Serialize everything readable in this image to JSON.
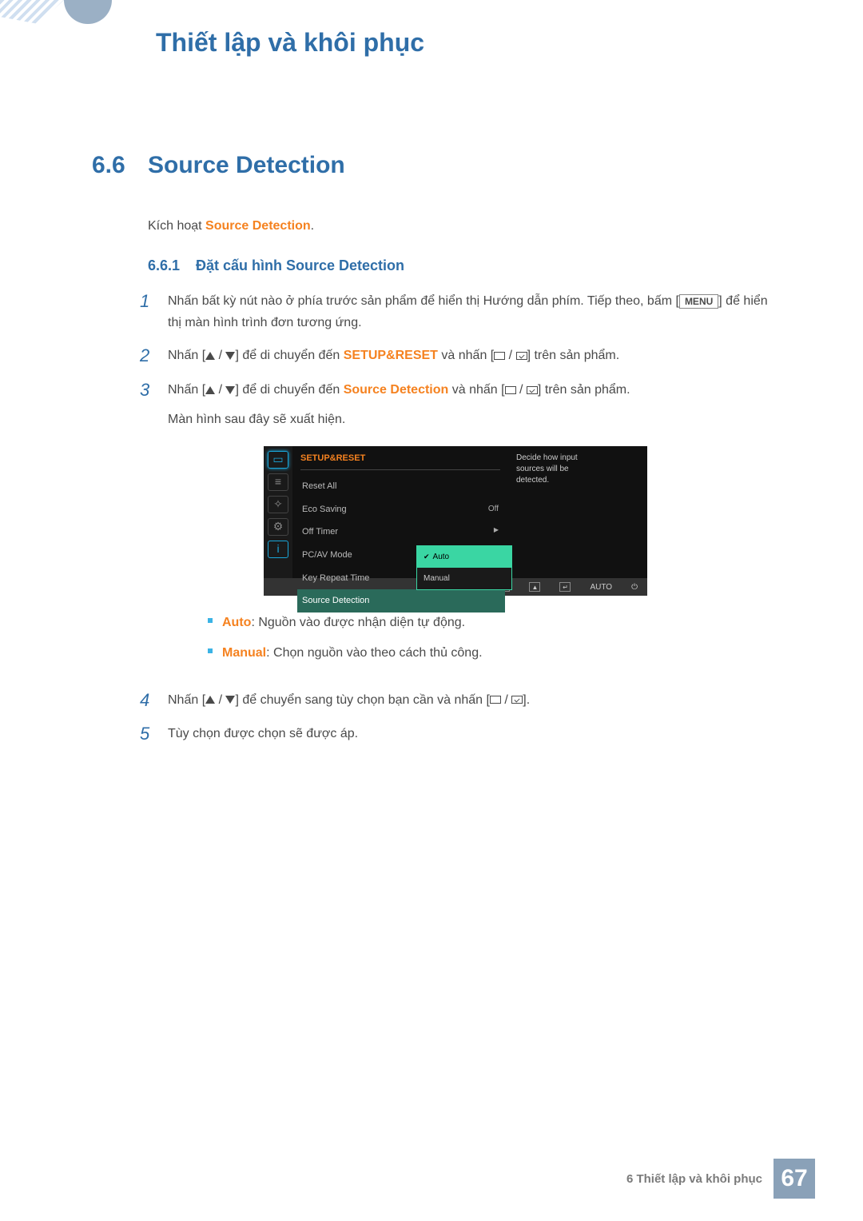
{
  "chapter_title": "Thiết lập và khôi phục",
  "section": {
    "num": "6.6",
    "title": "Source Detection"
  },
  "intro": {
    "prefix": "Kích hoạt ",
    "term": "Source Detection"
  },
  "subsection": {
    "num": "6.6.1",
    "title": "Đặt cấu hình Source Detection"
  },
  "steps": {
    "s1": {
      "num": "1",
      "a": "Nhấn bất kỳ nút nào ở phía trước sản phẩm để hiển thị Hướng dẫn phím. Tiếp theo, bấm [",
      "menu": "MENU",
      "b": "] để hiển thị màn hình trình đơn tương ứng."
    },
    "s2": {
      "num": "2",
      "a": "Nhấn [",
      "b": "] để di chuyển đến ",
      "target": "SETUP&RESET",
      "c": " và nhấn [",
      "d": "] trên sản phẩm."
    },
    "s3": {
      "num": "3",
      "a": "Nhấn [",
      "b": "] để di chuyển đến ",
      "target": "Source Detection",
      "c": " và nhấn [",
      "d": "] trên sản phẩm.",
      "after": "Màn hình sau đây sẽ xuất hiện."
    },
    "s4": {
      "num": "4",
      "a": "Nhấn [",
      "b": "] để chuyển sang tùy chọn bạn cần và nhấn [",
      "c": "]."
    },
    "s5": {
      "num": "5",
      "text": "Tùy chọn được chọn sẽ được áp."
    }
  },
  "osd": {
    "header": "SETUP&RESET",
    "items": {
      "reset": "Reset All",
      "eco": "Eco Saving",
      "eco_val": "Off",
      "timer": "Off Timer",
      "pcav": "PC/AV Mode",
      "keyrep": "Key Repeat Time",
      "srcdet": "Source Detection"
    },
    "tip": "Decide how input sources will be detected.",
    "popup": {
      "auto": "Auto",
      "manual": "Manual"
    },
    "footer_auto": "AUTO"
  },
  "bullets": {
    "auto": {
      "term": "Auto",
      "desc": ": Nguồn vào được nhận diện tự động."
    },
    "manual": {
      "term": "Manual",
      "desc": ": Chọn nguồn vào theo cách thủ công."
    }
  },
  "footer": {
    "chapter": "6 Thiết lập và khôi phục",
    "page": "67"
  }
}
